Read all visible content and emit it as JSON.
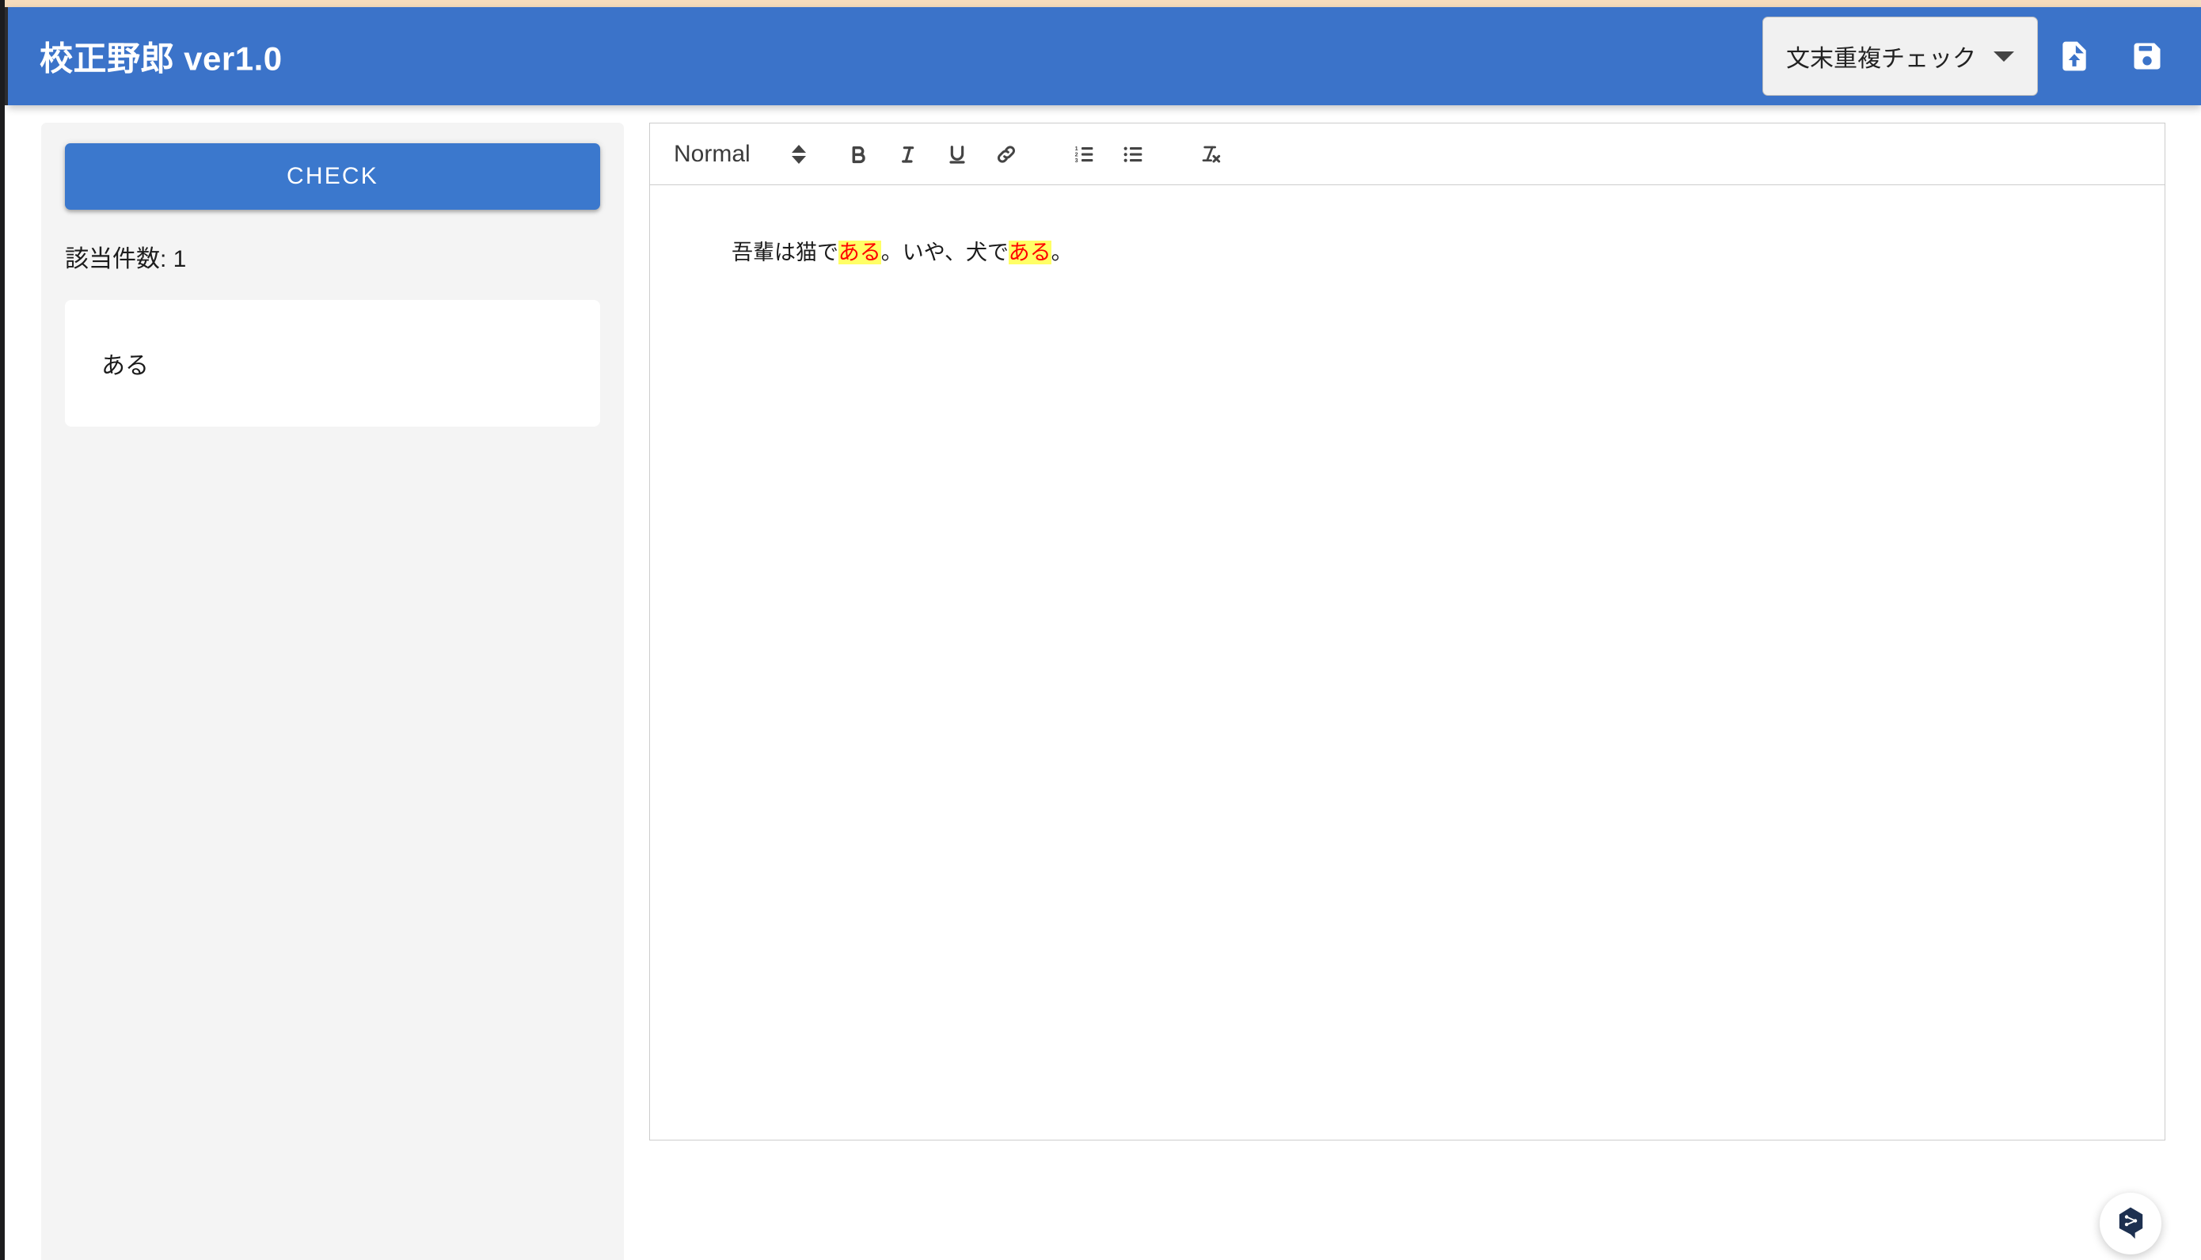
{
  "app": {
    "title": "校正野郎 ver1.0",
    "header_bg": "#3b73c9",
    "accent": "#3b78cd"
  },
  "header": {
    "mode_select": {
      "selected": "文末重複チェック",
      "options": [
        "文末重複チェック"
      ]
    },
    "upload_icon": "file-upload-icon",
    "save_icon": "save-icon"
  },
  "sidebar": {
    "check_button_label": "CHECK",
    "hit_count_label": "該当件数: 1",
    "results": [
      {
        "text": "ある"
      }
    ]
  },
  "editor": {
    "toolbar": {
      "format_label": "Normal",
      "buttons": [
        {
          "name": "bold",
          "glyph": "B"
        },
        {
          "name": "italic",
          "glyph": "I"
        },
        {
          "name": "underline",
          "glyph": "U"
        },
        {
          "name": "link",
          "glyph": "link"
        },
        {
          "name": "ordered-list",
          "glyph": "1 2 3"
        },
        {
          "name": "bullet-list",
          "glyph": "bullets"
        },
        {
          "name": "clear-format",
          "glyph": "Tx"
        }
      ]
    },
    "content": {
      "full_text": "吾輩は猫である。いや、犬である。",
      "segments": [
        {
          "text": "吾輩は猫で",
          "highlight": false
        },
        {
          "text": "ある",
          "highlight": true
        },
        {
          "text": "。いや、犬で",
          "highlight": false
        },
        {
          "text": "ある",
          "highlight": true
        },
        {
          "text": "。",
          "highlight": false
        }
      ],
      "highlight_bg": "#ffff66",
      "highlight_color": "#ff0000"
    }
  },
  "widget": {
    "chat_icon": "chat-bubble-icon"
  }
}
